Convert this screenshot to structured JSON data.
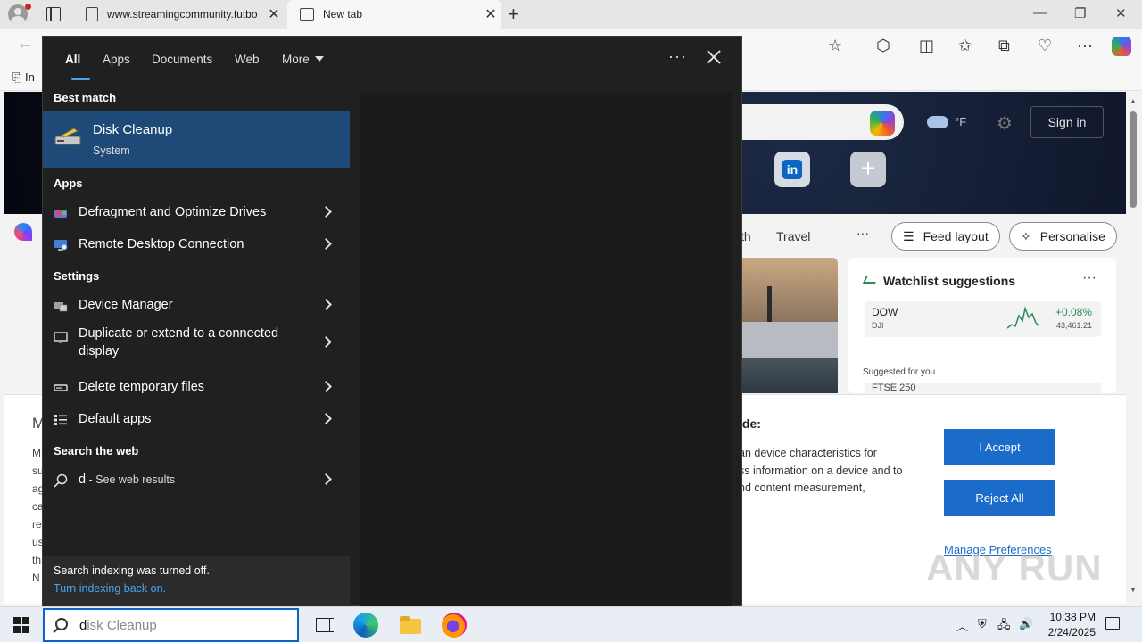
{
  "browser": {
    "tabs": [
      {
        "title": "www.streamingcommunity.futbo",
        "close": "✕"
      },
      {
        "title": "New tab",
        "close": "✕"
      }
    ],
    "new_tab": "+",
    "window_controls": {
      "minimize": "—",
      "restore": "❐",
      "close": "✕"
    },
    "favorites_first": "In"
  },
  "page": {
    "sign_in": "Sign in",
    "nav": {
      "item_health_tail": "th",
      "travel": "Travel",
      "more": "···",
      "feed_layout": "Feed layout",
      "personalise": "Personalise"
    },
    "linkedin_letter": "in",
    "add_tile": "+",
    "watchlist": {
      "title": "Watchlist suggestions",
      "more": "···",
      "stock": {
        "name": "DOW",
        "symbol": "DJI",
        "change": "+0.08%",
        "value": "43,461.21"
      },
      "suggested_label": "Suggested for you",
      "partial_stock": "FTSE 250"
    },
    "cookie": {
      "heading_tail": "ide:",
      "body_lines": [
        "an device characteristics for",
        "ss information on a device and to",
        "nd content measurement,"
      ],
      "accept": "I Accept",
      "reject": "Reject All",
      "manage": "Manage Preferences",
      "left_partial_heading": "M",
      "left_partial_lines": [
        "M",
        "su",
        "ag",
        "ca",
        "re",
        "us",
        "th",
        "N"
      ]
    },
    "watermark": "ANY RUN"
  },
  "flyout": {
    "tabs": [
      "All",
      "Apps",
      "Documents",
      "Web",
      "More"
    ],
    "more_options": "···",
    "sections": {
      "best_match": "Best match",
      "apps": "Apps",
      "settings": "Settings",
      "search_web": "Search the web"
    },
    "best_match": {
      "name": "Disk Cleanup",
      "subtitle": "System"
    },
    "apps": [
      {
        "label": "Defragment and Optimize Drives",
        "icon": "defrag-icon"
      },
      {
        "label": "Remote Desktop Connection",
        "icon": "remote-desktop-icon"
      }
    ],
    "settings": [
      {
        "label": "Device Manager",
        "icon": "device-manager-icon"
      },
      {
        "label": "Duplicate or extend to a connected display",
        "icon": "monitor-icon"
      },
      {
        "label": "Delete temporary files",
        "icon": "storage-icon"
      },
      {
        "label": "Default apps",
        "icon": "default-apps-icon"
      }
    ],
    "web": {
      "query": "d",
      "suffix": " - See web results"
    },
    "indexing": {
      "message": "Search indexing was turned off.",
      "link": "Turn indexing back on."
    }
  },
  "taskbar": {
    "search": {
      "typed": "d",
      "completion": "isk Cleanup"
    },
    "clock": {
      "time": "10:38 PM",
      "date": "2/24/2025"
    }
  }
}
